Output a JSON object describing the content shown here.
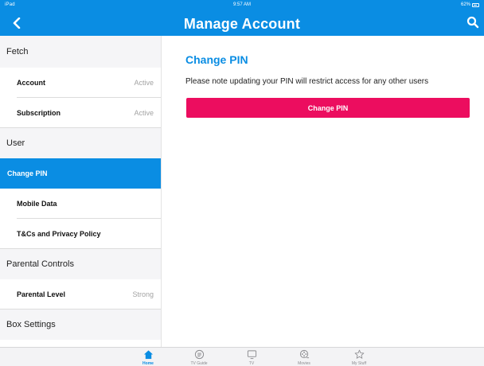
{
  "status_bar": {
    "carrier": "iPad",
    "time": "9:57 AM",
    "battery": "62%"
  },
  "header": {
    "title": "Manage Account",
    "back_icon": "chevron-left-icon",
    "search_icon": "search-icon"
  },
  "sidebar": {
    "sections": [
      {
        "header": "Fetch",
        "items": [
          {
            "label": "Account",
            "state": "Active"
          },
          {
            "label": "Subscription",
            "state": "Active"
          }
        ]
      },
      {
        "header": "User",
        "items": [
          {
            "label": "Change PIN",
            "state": "",
            "active": true
          },
          {
            "label": "Mobile Data",
            "state": ""
          },
          {
            "label": "T&Cs and Privacy Policy",
            "state": ""
          }
        ]
      },
      {
        "header": "Parental Controls",
        "items": [
          {
            "label": "Parental Level",
            "state": "Strong"
          }
        ]
      },
      {
        "header": "Box Settings",
        "items": []
      }
    ]
  },
  "main": {
    "title": "Change PIN",
    "note": "Please note updating your PIN will restrict access for any other users",
    "button_label": "Change PIN"
  },
  "tabbar": {
    "tabs": [
      {
        "label": "Home",
        "icon": "home-icon",
        "active": true
      },
      {
        "label": "TV Guide",
        "icon": "tv-guide-icon",
        "active": false
      },
      {
        "label": "TV",
        "icon": "tv-icon",
        "active": false
      },
      {
        "label": "Movies",
        "icon": "movies-icon",
        "active": false
      },
      {
        "label": "My Stuff",
        "icon": "star-icon",
        "active": false
      }
    ]
  },
  "colors": {
    "brand_blue": "#0a8de3",
    "accent_pink": "#ec0d5f"
  }
}
